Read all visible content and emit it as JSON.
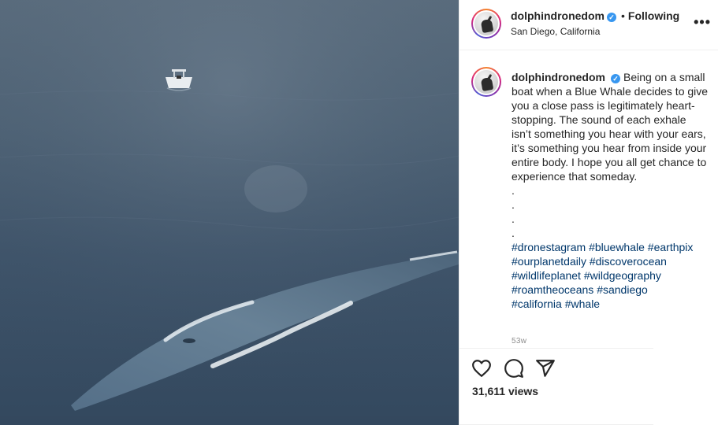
{
  "post": {
    "username": "dolphindronedom",
    "follow_separator": "•",
    "follow_status": "Following",
    "location": "San Diego, California",
    "more_glyph": "•••"
  },
  "caption": {
    "username": "dolphindronedom",
    "text": "Being on a small boat when a Blue Whale decides to give you a close pass is legitimately heart-stopping. The sound of each exhale isn’t something you hear with your ears, it’s something you hear from inside your entire body. I hope you all get chance to experience that someday.",
    "dots": [
      ".",
      ".",
      ".",
      "."
    ],
    "hashtags": [
      "#dronestagram",
      "#bluewhale",
      "#earthpix",
      "#ourplanetdaily",
      "#discoverocean",
      "#wildlifeplanet",
      "#wildgeography",
      "#roamtheoceans",
      "#sandiego",
      "#california",
      "#whale"
    ]
  },
  "timestamp": "53w",
  "views": "31,611 views",
  "icons": {
    "like": "heart-icon",
    "comment": "comment-bubble-icon",
    "share": "paper-plane-icon",
    "verified": "verified-badge-icon"
  },
  "colors": {
    "link": "#00376b",
    "verified": "#3897f0",
    "ocean": "#3f546a"
  }
}
